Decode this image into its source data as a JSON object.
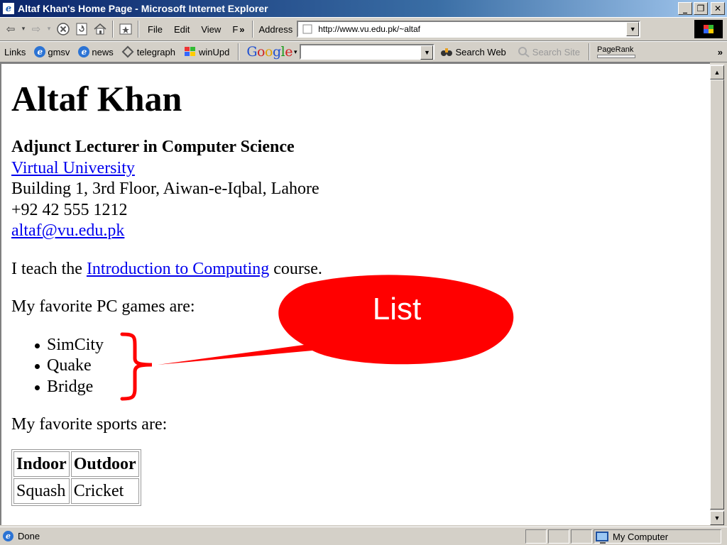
{
  "window": {
    "title": "Altaf Khan's Home Page - Microsoft Internet Explorer",
    "minimize": "_",
    "maximize": "❐",
    "close": "✕"
  },
  "toolbar": {
    "menu": [
      "File",
      "Edit",
      "View",
      "F"
    ],
    "overflow": "»",
    "address_label": "Address",
    "address_url": "http://www.vu.edu.pk/~altaf",
    "icons": [
      "back-icon",
      "forward-icon",
      "stop-icon",
      "refresh-icon",
      "home-icon",
      "favorites-icon"
    ]
  },
  "links_bar": {
    "label": "Links",
    "items": [
      "gmsv",
      "news",
      "telegraph",
      "winUpd"
    ],
    "google": "Google",
    "search_web": "Search Web",
    "search_site": "Search Site",
    "pagerank": "PageRank",
    "overflow": "»"
  },
  "page": {
    "heading": "Altaf Khan",
    "position": "Adjunct Lecturer in Computer Science",
    "university": "Virtual University",
    "address": "Building 1, 3rd Floor, Aiwan-e-Iqbal, Lahore",
    "phone": "+92 42 555 1212",
    "email": "altaf@vu.edu.pk",
    "teach_prefix": "I teach the ",
    "teach_link": "Introduction to Computing",
    "teach_suffix": " course.",
    "games_intro": "My favorite PC games are:",
    "games": [
      "SimCity",
      "Quake",
      "Bridge"
    ],
    "sports_intro": "My favorite sports are:",
    "sports_table": {
      "headers": [
        "Indoor",
        "Outdoor"
      ],
      "row": [
        "Squash",
        "Cricket"
      ]
    }
  },
  "status": {
    "text": "Done",
    "zone": "My Computer"
  },
  "annotation": {
    "label": "List",
    "bubble_color": "#ff0000",
    "brace_color": "#ff0000"
  }
}
